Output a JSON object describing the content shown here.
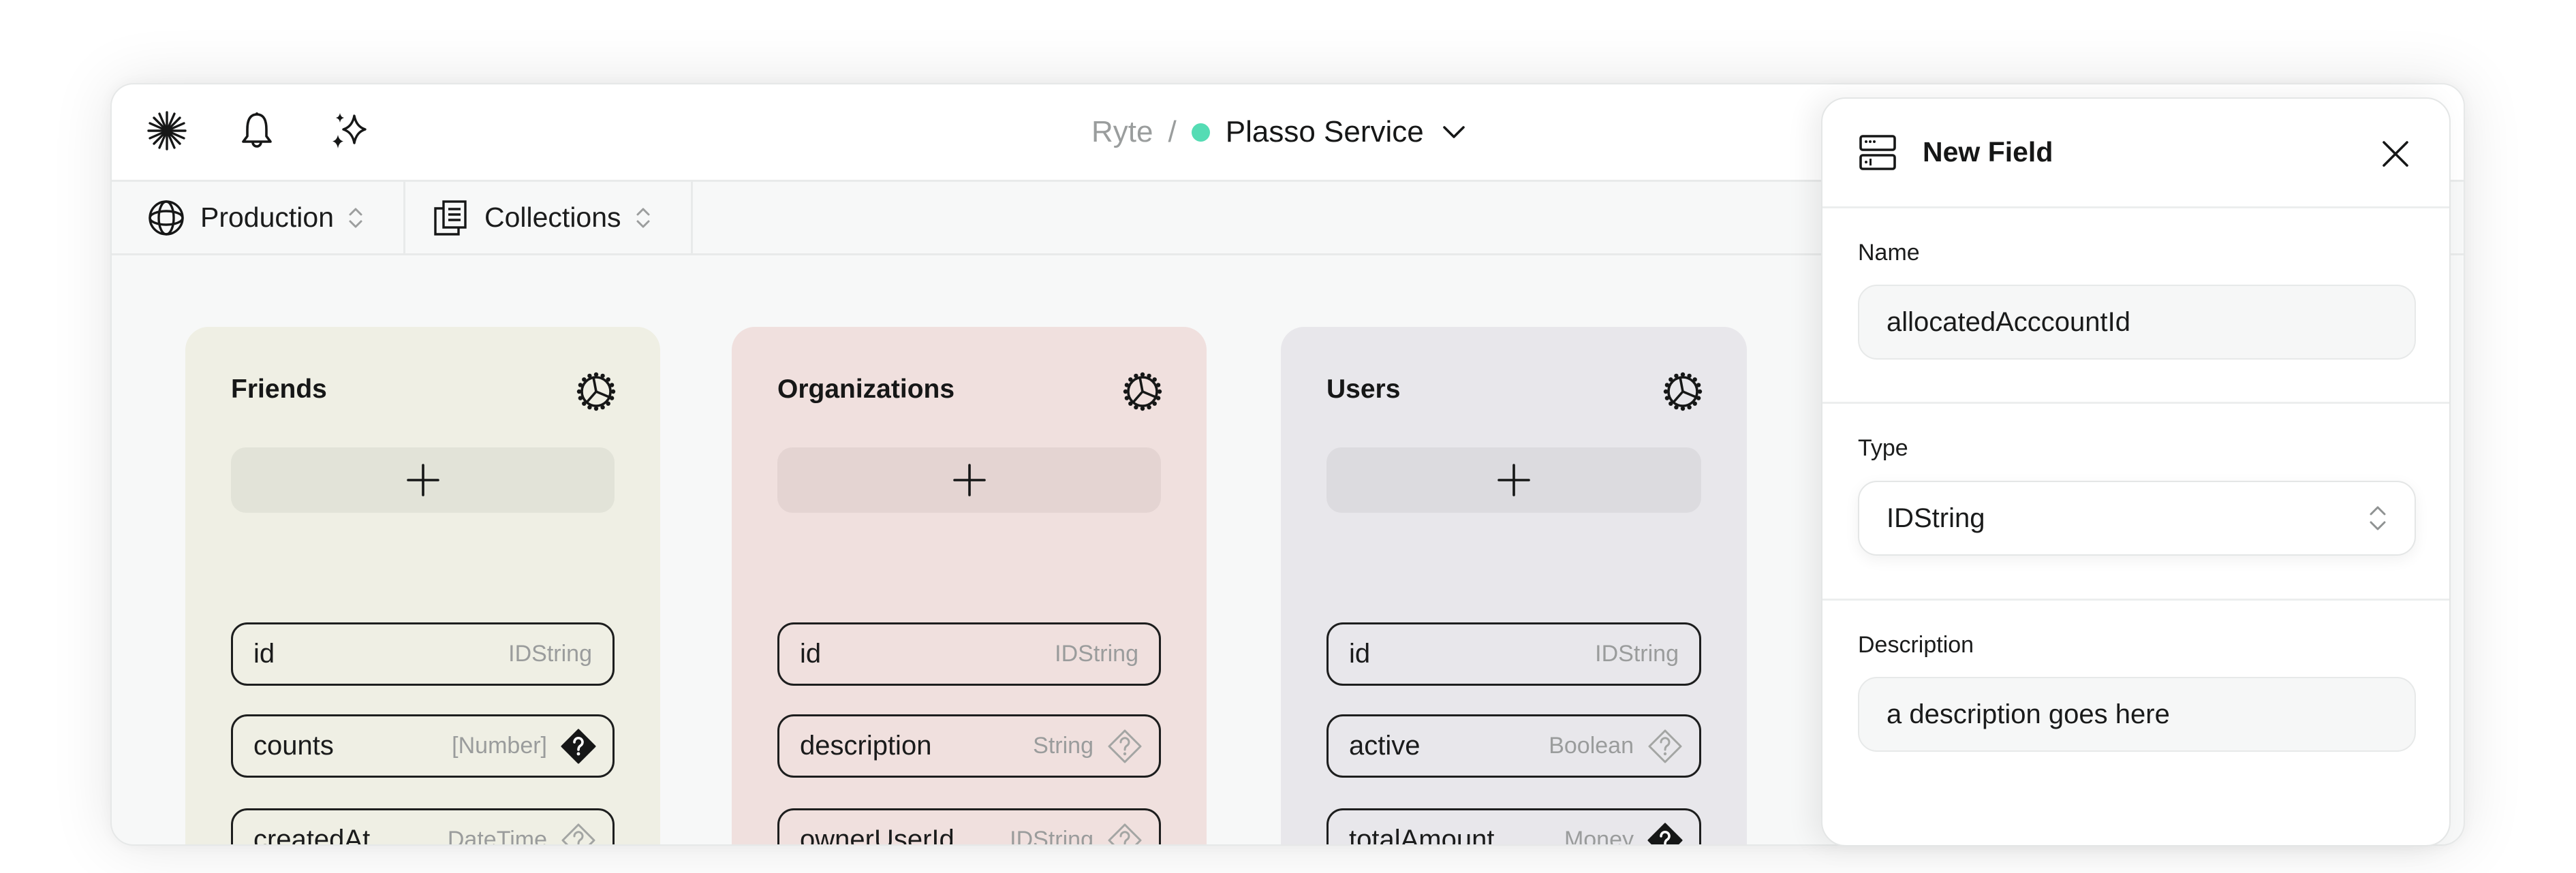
{
  "header": {
    "icons": [
      "starburst-icon",
      "bell-icon",
      "sparkles-icon"
    ],
    "breadcrumb": {
      "organization": "Ryte",
      "separator": "/",
      "service": "Plasso Service",
      "status_color": "#55dcb4"
    }
  },
  "toolbar": {
    "environment": {
      "label": "Production",
      "icon": "globe-icon"
    },
    "view": {
      "label": "Collections",
      "icon": "collections-icon"
    }
  },
  "collections": [
    {
      "name": "Friends",
      "bg_color": "#efefe4",
      "add_color": "#e2e3d8",
      "fields": [
        {
          "name": "id",
          "type": "IDString",
          "optional": null
        },
        {
          "name": "counts",
          "type": "[Number]",
          "optional": "required"
        },
        {
          "name": "createdAt",
          "type": "DateTime",
          "optional": "optional"
        }
      ]
    },
    {
      "name": "Organizations",
      "bg_color": "#f0e0de",
      "add_color": "#e4d4d2",
      "fields": [
        {
          "name": "id",
          "type": "IDString",
          "optional": null
        },
        {
          "name": "description",
          "type": "String",
          "optional": "optional"
        },
        {
          "name": "ownerUserId",
          "type": "IDString",
          "optional": "optional"
        }
      ]
    },
    {
      "name": "Users",
      "bg_color": "#e8e7eb",
      "add_color": "#dcdbdf",
      "fields": [
        {
          "name": "id",
          "type": "IDString",
          "optional": null
        },
        {
          "name": "active",
          "type": "Boolean",
          "optional": "optional"
        },
        {
          "name": "totalAmount",
          "type": "Money",
          "optional": "required"
        }
      ]
    }
  ],
  "panel": {
    "title": "New Field",
    "name": {
      "label": "Name",
      "value": "allocatedAcccountId"
    },
    "type": {
      "label": "Type",
      "value": "IDString"
    },
    "description": {
      "label": "Description",
      "value": "a description goes here"
    }
  }
}
